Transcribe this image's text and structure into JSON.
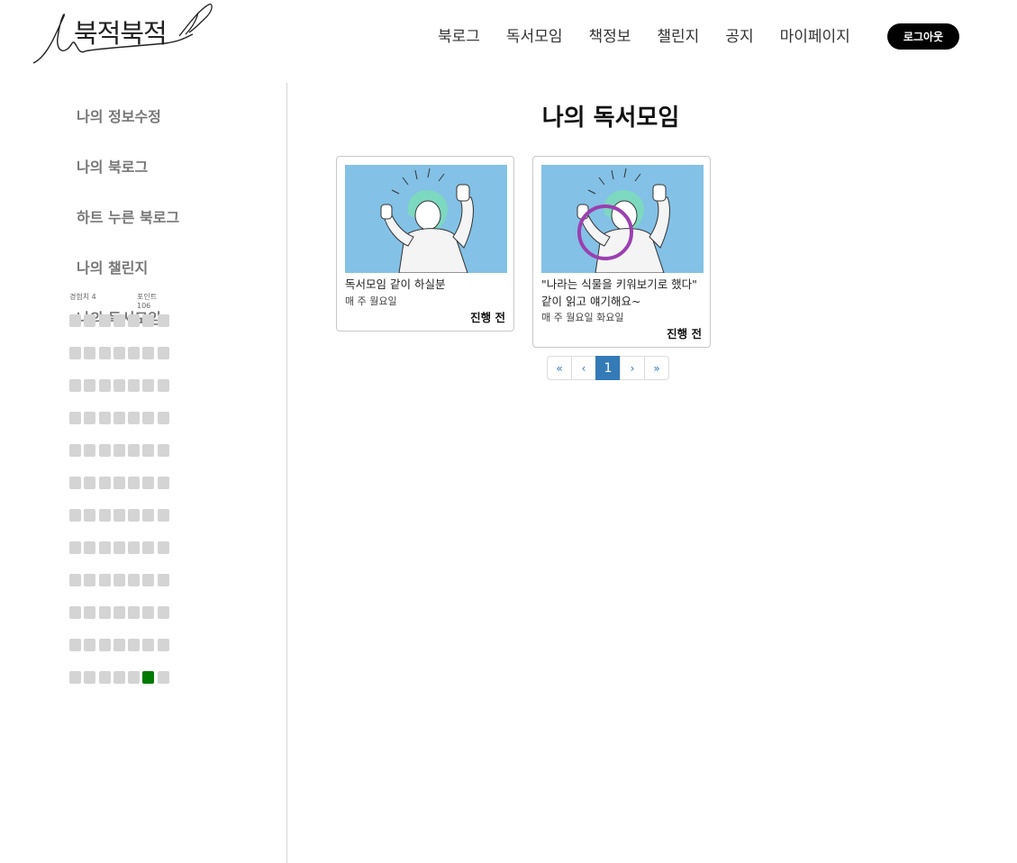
{
  "header": {
    "logo_text": "북적북적",
    "nav": [
      "북로그",
      "독서모임",
      "책정보",
      "챌린지",
      "공지",
      "마이페이지"
    ],
    "logout_label": "로그아웃"
  },
  "sidebar": {
    "menu": [
      "나의 정보수정",
      "나의 북로그",
      "하트 누른 북로그",
      "나의 챌린지",
      "나의 독서모임"
    ],
    "experience_label": "경험치 4",
    "points_label": "포인트 106",
    "activity_grid": {
      "rows": 12,
      "cols": 7,
      "active_cells": [
        [
          11,
          5
        ]
      ]
    }
  },
  "main": {
    "title": "나의 독서모임",
    "cards": [
      {
        "title": "독서모임 같이 하실분",
        "schedule": "매 주 월요일",
        "status": "진행 전"
      },
      {
        "title": "\"나라는 식물을 키워보기로 했다\" 같이 읽고 얘기해요~",
        "schedule": "매 주 월요일 화요일",
        "status": "진행 전"
      }
    ],
    "pagination": {
      "first": "«",
      "prev": "‹",
      "current": "1",
      "next": "›",
      "last": "»"
    }
  },
  "colors": {
    "accent": "#337ab7",
    "thumb_bg": "#83c1e6",
    "grid_active": "#007a00",
    "grid_inactive": "#d4d4d4",
    "annotation_circle": "#9b3fb0"
  }
}
